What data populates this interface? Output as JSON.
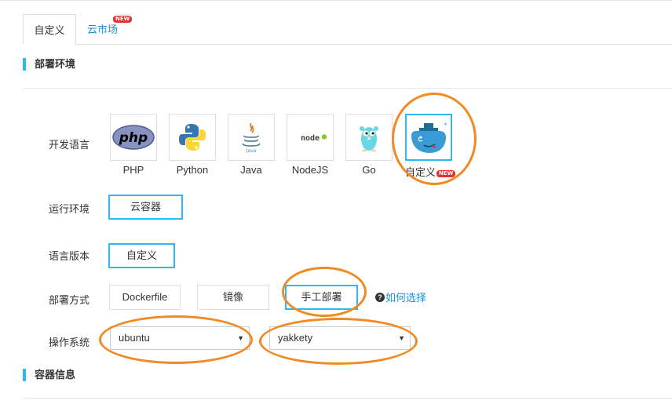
{
  "tabs": [
    {
      "label": "自定义"
    },
    {
      "label": "云市场",
      "badge": "NEW"
    }
  ],
  "sections": {
    "deploy_env": "部署环境",
    "container_info": "容器信息"
  },
  "form": {
    "language": {
      "label": "开发语言",
      "options": [
        {
          "name": "PHP",
          "icon": "php-icon"
        },
        {
          "name": "Python",
          "icon": "python-icon"
        },
        {
          "name": "Java",
          "icon": "java-icon"
        },
        {
          "name": "NodeJS",
          "icon": "nodejs-icon"
        },
        {
          "name": "Go",
          "icon": "go-icon"
        },
        {
          "name": "自定义",
          "icon": "docker-icon",
          "badge": "NEW",
          "selected": true
        }
      ]
    },
    "runtime": {
      "label": "运行环境",
      "value": "云容器"
    },
    "version": {
      "label": "语言版本",
      "value": "自定义"
    },
    "deploy_method": {
      "label": "部署方式",
      "options": [
        "Dockerfile",
        "镜像",
        "手工部署"
      ],
      "selected": "手工部署",
      "help": "如何选择"
    },
    "os": {
      "label": "操作系统",
      "distro": "ubuntu",
      "release": "yakkety"
    }
  },
  "colors": {
    "accent": "#2cb7f5",
    "link": "#1a8fd8",
    "annotation": "#f08a24",
    "badge": "#e4312b"
  }
}
